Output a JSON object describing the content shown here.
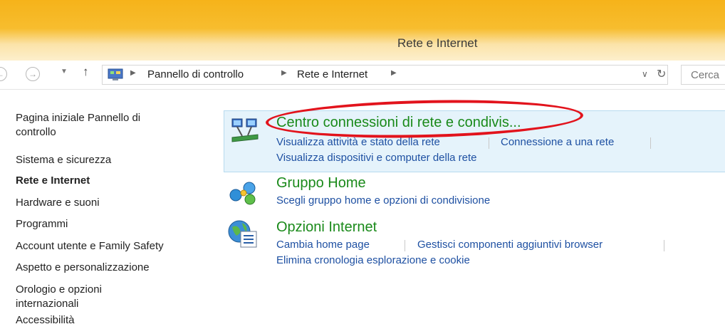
{
  "window": {
    "title": "Rete e Internet"
  },
  "nav": {
    "back_icon": "back-arrow-icon",
    "forward_icon": "forward-arrow-icon",
    "up_icon": "up-arrow-icon"
  },
  "breadcrumb": [
    "Pannello di controllo",
    "Rete e Internet"
  ],
  "search": {
    "placeholder": "Cerca"
  },
  "sidebar": {
    "items": [
      {
        "label_lines": [
          "Pagina iniziale Pannello di",
          "controllo"
        ]
      },
      {
        "label": "Sistema e sicurezza"
      },
      {
        "label": "Rete e Internet",
        "active": true
      },
      {
        "label": "Hardware e suoni"
      },
      {
        "label": "Programmi"
      },
      {
        "label": "Account utente e Family Safety"
      },
      {
        "label": "Aspetto e personalizzazione"
      },
      {
        "label_lines": [
          "Orologio e opzioni",
          "internazionali"
        ]
      },
      {
        "label": "Accessibilità"
      }
    ]
  },
  "categories": [
    {
      "title": "Centro connessioni di rete e condivis...",
      "icon": "network-sharing-center-icon",
      "links": [
        "Visualizza attività e stato della rete",
        "Connessione a una rete",
        "Visualizza dispositivi e computer della rete"
      ],
      "highlighted": true
    },
    {
      "title": "Gruppo Home",
      "icon": "homegroup-icon",
      "links": [
        "Scegli gruppo home e opzioni di condivisione"
      ]
    },
    {
      "title": "Opzioni Internet",
      "icon": "internet-options-icon",
      "links": [
        "Cambia home page",
        "Gestisci componenti aggiuntivi browser",
        "Elimina cronologia esplorazione e cookie"
      ]
    }
  ],
  "colors": {
    "accent_title": "#1a8a1a",
    "link": "#1e50a2",
    "annotation_circle": "#e2131c",
    "titlebar": "#f6b31a"
  }
}
